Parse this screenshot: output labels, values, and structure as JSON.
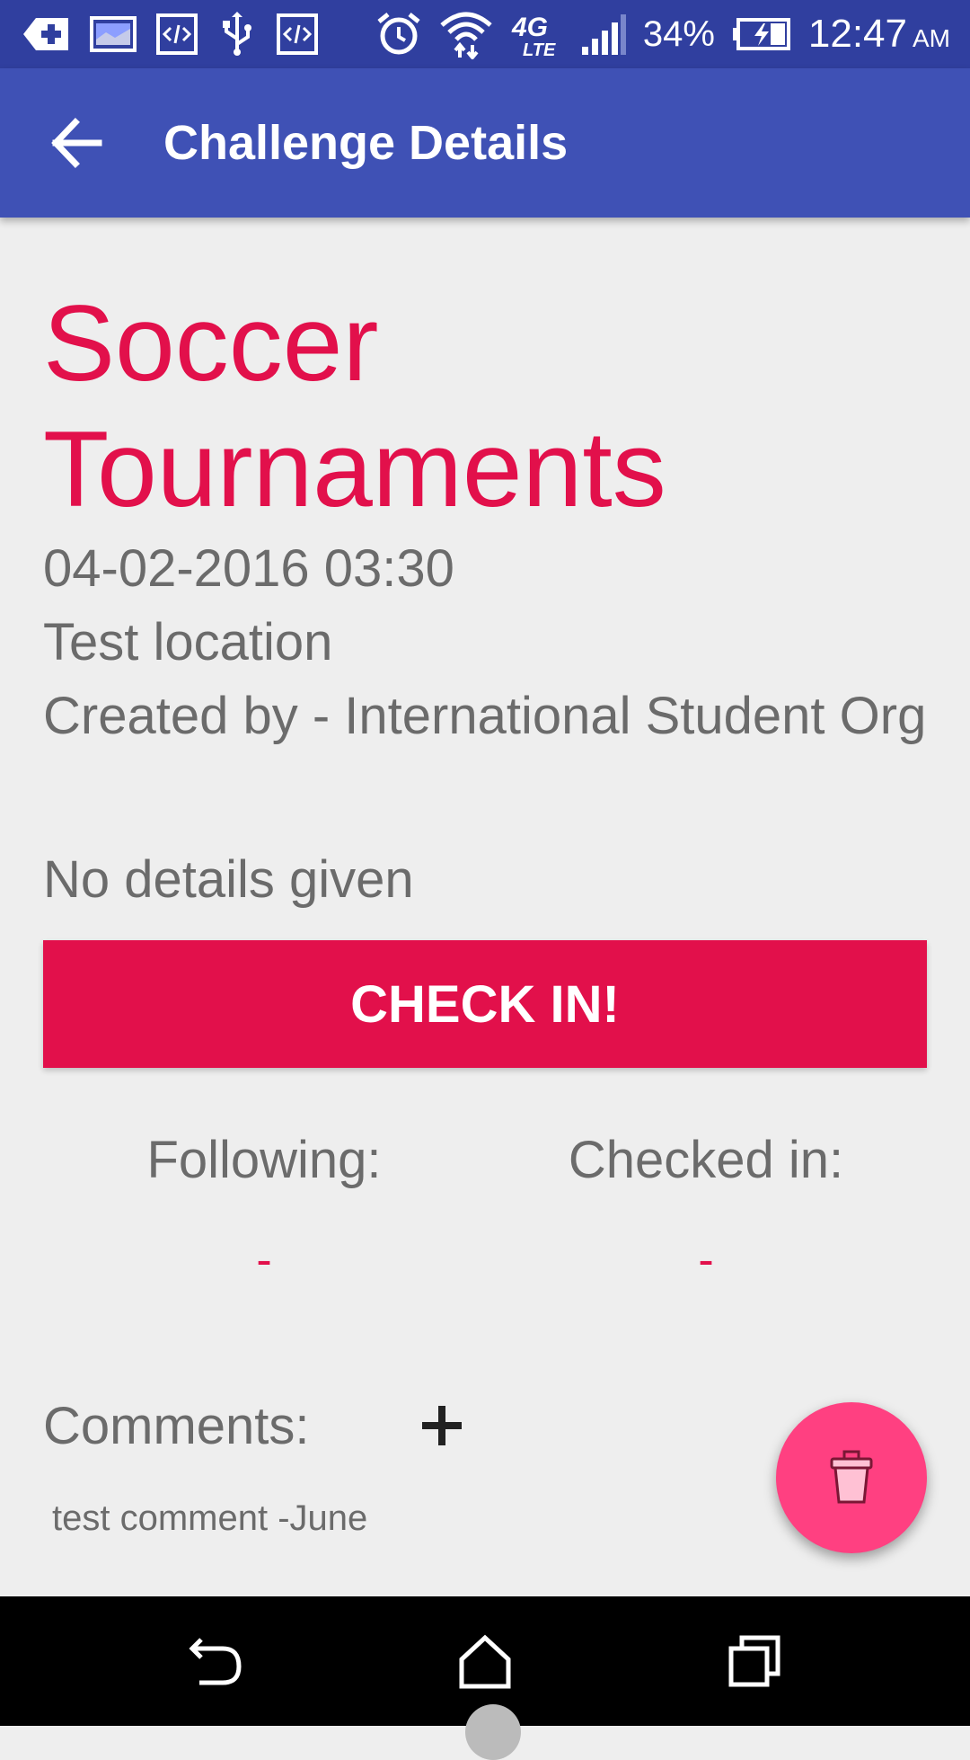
{
  "status_bar": {
    "icons": [
      "health-plus-icon",
      "image-icon",
      "code-icon",
      "usb-icon",
      "code-icon",
      "alarm-icon",
      "wifi-icon",
      "4g-lte-icon",
      "signal-icon",
      "battery-charging-icon"
    ],
    "network": "4G LTE",
    "battery": "34%",
    "time": "12:47",
    "ampm": "AM"
  },
  "app_bar": {
    "title": "Challenge Details",
    "back_icon": "arrow-back-icon"
  },
  "challenge": {
    "title": "Soccer Tournaments",
    "datetime": "04-02-2016 03:30",
    "location": "Test location",
    "creator": "Created by - International Student Org",
    "details": "No details given"
  },
  "checkin_label": "CHECK IN!",
  "stats": {
    "following_label": "Following:",
    "following_value": "-",
    "checkedin_label": "Checked in:",
    "checkedin_value": "-"
  },
  "comments": {
    "label": "Comments:",
    "add_icon": "plus-icon",
    "items": [
      "test comment -June"
    ]
  },
  "fab": {
    "icon": "trash-icon"
  },
  "nav_bar": {
    "icons": [
      "back-icon",
      "home-icon",
      "recents-icon"
    ]
  },
  "colors": {
    "status_bar": "#303f9f",
    "app_bar": "#3f51b5",
    "accent": "#e2104b",
    "fab": "#ff4081",
    "background": "#eeeeee"
  }
}
